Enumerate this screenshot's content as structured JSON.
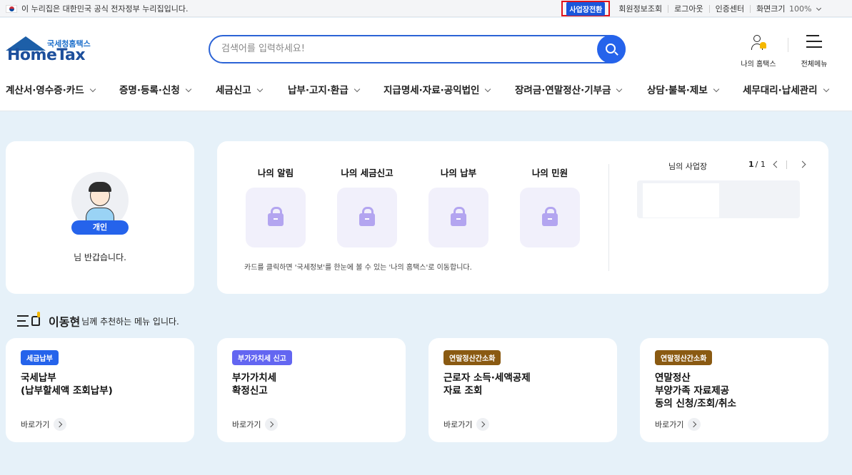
{
  "gov_notice": "이 누리집은 대한민국 공식 전자정부 누리집입니다.",
  "top_links": {
    "biz_switch": "사업장전환",
    "member_info": "회원정보조회",
    "logout": "로그아웃",
    "cert_center": "인증센터",
    "screen_size_label": "화면크기",
    "screen_size_value": "100%"
  },
  "logo": {
    "sub": "국세청홈택스",
    "main": "HomeTax"
  },
  "search": {
    "placeholder": "검색어를 입력하세요!"
  },
  "header_icons": {
    "my_hometax": "나의 홈택스",
    "all_menu": "전체메뉴"
  },
  "gnb": [
    "계산서·영수증·카드",
    "증명·등록·신청",
    "세금신고",
    "납부·고지·환급",
    "지급명세·자료·공익법인",
    "장려금·연말정산·기부금",
    "상담·불복·제보",
    "세무대리·납세관리"
  ],
  "profile": {
    "badge": "개인",
    "greeting": "님 반갑습니다."
  },
  "my_tiles": [
    "나의 알림",
    "나의 세금신고",
    "나의 납부",
    "나의 민원"
  ],
  "panel_note": "카드를 클릭하면 '국세정보'를 한눈에 볼 수 있는 '나의 홈택스'로 이동합니다.",
  "business": {
    "label": "님의 사업장",
    "page_current": "1",
    "page_total": "/ 1"
  },
  "recommend": {
    "name": "이동현",
    "suffix": "님께 추천하는 메뉴 입니다."
  },
  "rec_cards": [
    {
      "tag": "세금납부",
      "tag_color": "#2563eb",
      "line1": "국세납부",
      "line2": "(납부할세액 조회납부)",
      "line3": "",
      "go": "바로가기"
    },
    {
      "tag": "부가가치세 신고",
      "tag_color": "#6366f1",
      "line1": "부가가치세",
      "line2": "확정신고",
      "line3": "",
      "go": "바로가기"
    },
    {
      "tag": "연말정산간소화",
      "tag_color": "#8a5a12",
      "line1": "근로자 소득·세액공제",
      "line2": "자료 조회",
      "line3": "",
      "go": "바로가기"
    },
    {
      "tag": "연말정산간소화",
      "tag_color": "#8a5a12",
      "line1": "연말정산",
      "line2": "부양가족 자료제공",
      "line3": "동의 신청/조회/취소",
      "go": "바로가기"
    }
  ]
}
